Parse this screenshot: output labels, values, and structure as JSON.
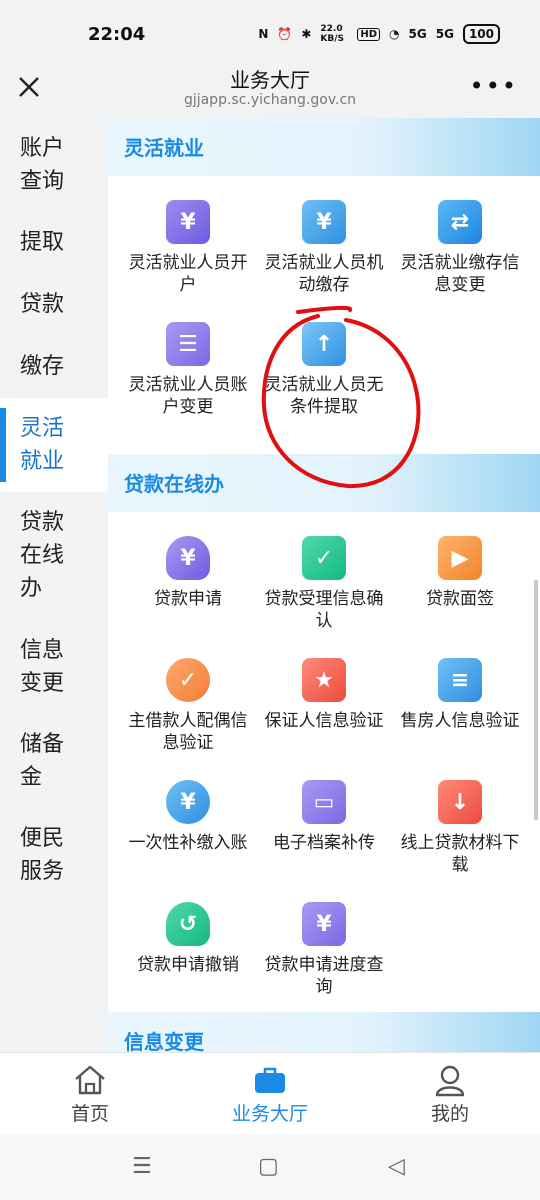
{
  "status_bar": {
    "time": "22:04",
    "net_speed": "22.0 KB/S",
    "hd": "HD",
    "sig1": "5G",
    "sig2": "5G",
    "battery": "100"
  },
  "header": {
    "title": "业务大厅",
    "url": "gjjapp.sc.yichang.gov.cn",
    "more": "•••"
  },
  "sidebar": {
    "items": [
      {
        "label": "账户\n查询"
      },
      {
        "label": "提取"
      },
      {
        "label": "贷款"
      },
      {
        "label": "缴存"
      },
      {
        "label": "灵活\n就业"
      },
      {
        "label": "贷款\n在线\n办"
      },
      {
        "label": "信息\n变更"
      },
      {
        "label": "储备\n金"
      },
      {
        "label": "便民\n服务"
      }
    ]
  },
  "sections": {
    "flexible": {
      "title": "灵活就业",
      "tiles": [
        {
          "label": "灵活就业人员开户",
          "icon": "yuan-notebook-icon",
          "glyph": "¥"
        },
        {
          "label": "灵活就业人员机动缴存",
          "icon": "yuan-atm-icon",
          "glyph": "¥"
        },
        {
          "label": "灵活就业缴存信息变更",
          "icon": "card-exchange-icon",
          "glyph": "⇄"
        },
        {
          "label": "灵活就业人员账户变更",
          "icon": "document-settings-icon",
          "glyph": "☰"
        },
        {
          "label": "灵活就业人员无条件提取",
          "icon": "upload-file-icon",
          "glyph": "↑"
        }
      ]
    },
    "loan_online": {
      "title": "贷款在线办",
      "tiles": [
        {
          "label": "贷款申请",
          "icon": "money-bag-icon",
          "glyph": "¥"
        },
        {
          "label": "贷款受理信息确认",
          "icon": "check-document-icon",
          "glyph": "✓"
        },
        {
          "label": "贷款面签",
          "icon": "video-camera-icon",
          "glyph": "▶"
        },
        {
          "label": "主借款人配偶信息验证",
          "icon": "user-verify-icon",
          "glyph": "✓"
        },
        {
          "label": "保证人信息验证",
          "icon": "guarantor-card-icon",
          "glyph": "★"
        },
        {
          "label": "售房人信息验证",
          "icon": "seller-card-icon",
          "glyph": "≡"
        },
        {
          "label": "一次性补缴入账",
          "icon": "user-yuan-icon",
          "glyph": "¥"
        },
        {
          "label": "电子档案补传",
          "icon": "archive-box-icon",
          "glyph": "▭"
        },
        {
          "label": "线上贷款材料下载",
          "icon": "download-tray-icon",
          "glyph": "↓"
        },
        {
          "label": "贷款申请撤销",
          "icon": "money-bag-undo-icon",
          "glyph": "↺"
        },
        {
          "label": "贷款申请进度查询",
          "icon": "calendar-clock-icon",
          "glyph": "¥"
        }
      ]
    },
    "info_change": {
      "title": "信息变更"
    }
  },
  "bottom_nav": {
    "home": "首页",
    "hall": "业务大厅",
    "mine": "我的"
  },
  "colors": {
    "accent": "#1a8ae6",
    "annotation": "#e01010"
  }
}
